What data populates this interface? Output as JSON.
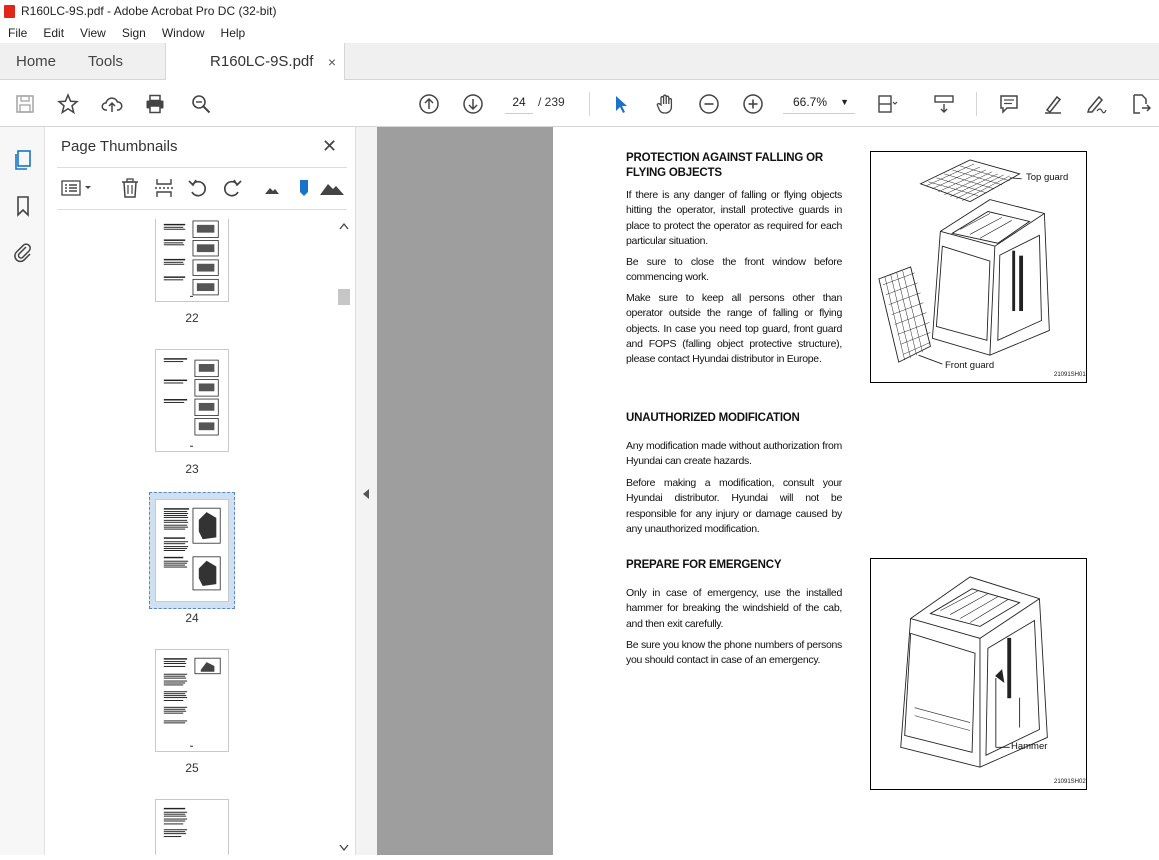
{
  "window": {
    "title": "R160LC-9S.pdf - Adobe Acrobat Pro DC (32-bit)"
  },
  "menu": [
    "File",
    "Edit",
    "View",
    "Sign",
    "Window",
    "Help"
  ],
  "tabs": {
    "home": "Home",
    "tools": "Tools",
    "document": "R160LC-9S.pdf",
    "close_symbol": "×"
  },
  "toolbar": {
    "current_page": "24",
    "page_total": "/ 239",
    "zoom": "66.7%"
  },
  "panel": {
    "title": "Page Thumbnails",
    "thumbnails": [
      {
        "label": "22"
      },
      {
        "label": "23"
      },
      {
        "label": "24",
        "selected": true
      },
      {
        "label": "25"
      }
    ]
  },
  "document_page": {
    "sections": [
      {
        "heading": "PROTECTION AGAINST FALLING OR FLYING OBJECTS",
        "paragraphs": [
          "If there is any danger of falling or flying objects hitting the operator, install protective guards in place to protect the operator as required for each particular situation.",
          "Be sure to close the front window before commencing work.",
          "Make sure to keep all persons other than operator outside the range of falling or flying objects. In case you need top guard, front guard and FOPS (falling object protective structure), please contact Hyundai distributor in Europe."
        ]
      },
      {
        "heading": "UNAUTHORIZED MODIFICATION",
        "paragraphs": [
          "Any modification made without authorization from Hyundai can create hazards.",
          "Before making a modification, consult your Hyundai distributor.  Hyundai will not be responsible for any injury or damage caused by any unauthorized modification."
        ]
      },
      {
        "heading": "PREPARE FOR EMERGENCY",
        "paragraphs": [
          "Only in case of emergency, use the installed hammer for breaking the windshield of the cab, and then exit carefully.",
          "Be sure you know the phone numbers of persons you should contact in case of an emergency."
        ]
      }
    ],
    "figure1": {
      "top_label": "Top guard",
      "front_label": "Front guard",
      "code": "21091SH01"
    },
    "figure2": {
      "hammer_label": "Hammer",
      "code": "21091SH02"
    }
  }
}
